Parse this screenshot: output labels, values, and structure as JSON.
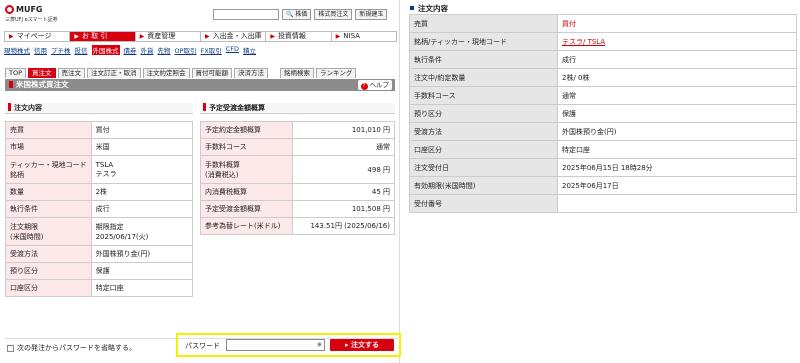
{
  "brand": {
    "name": "MUFG",
    "sub": "三菱UFJ eスマート証券"
  },
  "header": {
    "search_btn": "🔍 株価",
    "btn_stock": "株式買注文",
    "btn_recent": "新規建玉"
  },
  "main_nav": [
    {
      "label": "マイページ"
    },
    {
      "label": "お 取 引"
    },
    {
      "label": "資産管理"
    },
    {
      "label": "入出金・入出庫"
    },
    {
      "label": "投資情報"
    },
    {
      "label": "NISA"
    }
  ],
  "sub_nav": [
    "現物株式",
    "信用",
    "プチ株",
    "投信",
    "外国株式",
    "債券",
    "外貨",
    "先物",
    "OP取引",
    "FX取引",
    "CFD",
    "積立"
  ],
  "tabs": [
    "TOP",
    "買注文",
    "売注文",
    "注文訂正・取消",
    "注文約定照会",
    "買付可能額",
    "決済方法",
    "銘柄検索",
    "ランキング"
  ],
  "page_title": "米国株式買注文",
  "help_label": "ヘルプ",
  "order_section": {
    "title": "注文内容",
    "rows": [
      {
        "k": "売買",
        "v": "買付"
      },
      {
        "k": "市場",
        "v": "米国"
      },
      {
        "k": "ティッカー・現地コード",
        "k2": "銘柄",
        "v": "TSLA",
        "v2": "テスラ"
      },
      {
        "k": "数量",
        "v": "2株"
      },
      {
        "k": "執行条件",
        "v": "成行"
      },
      {
        "k": "注文期限",
        "k2": "(米国時間)",
        "v": "期限指定",
        "v2": "2025/06/17(火)"
      },
      {
        "k": "受渡方法",
        "v": "外国株預り金(円)"
      },
      {
        "k": "預り区分",
        "v": "保護"
      },
      {
        "k": "口座区分",
        "v": "特定口座"
      }
    ]
  },
  "estimate_section": {
    "title": "予定受渡金額概算",
    "rows": [
      {
        "k": "予定約定金額概算",
        "v": "101,010 円"
      },
      {
        "k": "手数料コース",
        "v": "通常"
      },
      {
        "k": "手数料概算",
        "k2": "(消費税込)",
        "v": "498 円"
      },
      {
        "k": "内消費税概算",
        "v": "45 円"
      },
      {
        "k": "予定受渡金額概算",
        "v": "101,508 円"
      },
      {
        "k": "参考為替レート(米ドル)",
        "v": "143.51円 (2025/06/16)"
      }
    ]
  },
  "bottom": {
    "skip_label": "次の発注からパスワードを省略する。",
    "password_label": "パスワード",
    "order_button": "注文する"
  },
  "detail": {
    "title": "注文内容",
    "rows": [
      {
        "k": "売買",
        "v": "買付",
        "style": "accent"
      },
      {
        "k": "銘柄/ティッカー・現地コード",
        "v": "テスラ/ TSLA",
        "style": "link"
      },
      {
        "k": "執行条件",
        "v": "成行"
      },
      {
        "k": "注文中/約定数量",
        "v": "2株/ 0株"
      },
      {
        "k": "手数料コース",
        "v": "通常"
      },
      {
        "k": "預り区分",
        "v": "保護"
      },
      {
        "k": "受渡方法",
        "v": "外国株預り金(円)"
      },
      {
        "k": "口座区分",
        "v": "特定口座"
      },
      {
        "k": "注文受付日",
        "v": "2025年06月15日 18時28分"
      },
      {
        "k": "有効期限(米国時間)",
        "v": "2025年06月17日"
      },
      {
        "k": "受付番号",
        "v": ""
      }
    ]
  },
  "colors": {
    "brand_red": "#d7000f",
    "highlight_yellow": "#f5f100",
    "key_pink": "#fce8e8",
    "key_gray": "#e6e6e6"
  },
  "icons": [
    "mufg-logo-icon",
    "search-icon",
    "triangle-right-icon",
    "help-icon",
    "eye-icon",
    "checkbox-icon"
  ]
}
